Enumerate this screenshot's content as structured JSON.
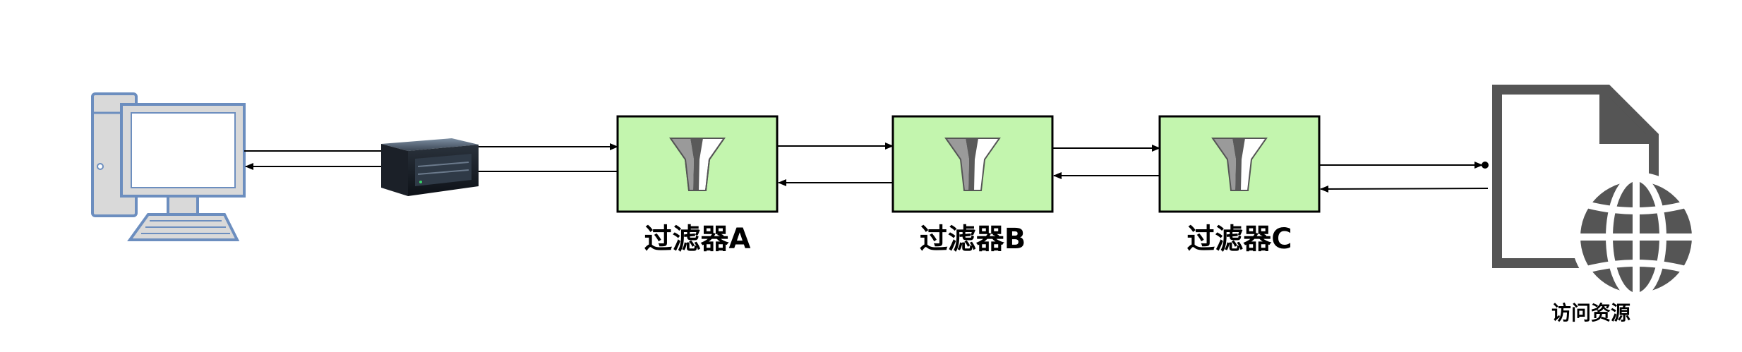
{
  "filters": [
    {
      "label": "过滤器A"
    },
    {
      "label": "过滤器B"
    },
    {
      "label": "过滤器C"
    }
  ],
  "resource": {
    "label": "访问资源"
  },
  "icons": {
    "client": "desktop-computer-icon",
    "server": "server-icon",
    "filter": "funnel-icon",
    "resource_document": "document-icon",
    "resource_web": "globe-icon"
  },
  "colors": {
    "filter_fill": "#c3f5ae",
    "filter_border": "#000000",
    "computer_stroke": "#6c8ebf",
    "computer_fill": "#d9d9d9",
    "resource_gray": "#555555",
    "line": "#000000"
  }
}
